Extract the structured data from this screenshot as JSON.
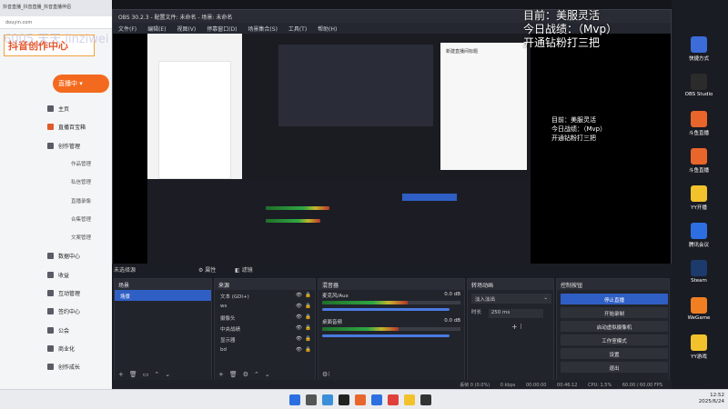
{
  "browser": {
    "tab_text": "抖音直播_抖音直播_抖音直播伴侣",
    "url": "douyin.com",
    "logo_text": "抖音创作中心",
    "live_button": "直播中",
    "nav": [
      {
        "label": "主页",
        "type": "main",
        "active": false
      },
      {
        "label": "直播百宝箱",
        "type": "main",
        "active": true
      },
      {
        "label": "创作管理",
        "type": "main",
        "active": false
      },
      {
        "label": "作品管理",
        "type": "sub",
        "active": false
      },
      {
        "label": "私信管理",
        "type": "sub",
        "active": false
      },
      {
        "label": "直播录像",
        "type": "sub",
        "active": false
      },
      {
        "label": "合集管理",
        "type": "sub",
        "active": false
      },
      {
        "label": "文案管理",
        "type": "sub",
        "active": false
      },
      {
        "label": "数据中心",
        "type": "main",
        "active": false
      },
      {
        "label": "收益",
        "type": "main",
        "active": false
      },
      {
        "label": "互动管理",
        "type": "main",
        "active": false
      },
      {
        "label": "签约中心",
        "type": "main",
        "active": false
      },
      {
        "label": "公会",
        "type": "main",
        "active": false
      },
      {
        "label": "商业化",
        "type": "main",
        "active": false
      },
      {
        "label": "创作成长",
        "type": "main",
        "active": false
      }
    ]
  },
  "watermark": {
    "text": "6005 天天 linziwei"
  },
  "obs": {
    "title": "OBS 30.2.3 - 配置文件: 未命名 - 场景: 未命名",
    "menu": [
      "文件(F)",
      "编辑(E)",
      "视图(V)",
      "停靠窗口(D)",
      "场景集合(S)",
      "工具(T)",
      "帮助(H)"
    ],
    "status_overlay": [
      "目前：美服灵活",
      "今日战绩：（Mvp）",
      "开通钻粉打三把"
    ],
    "right_panel_title": "新建直播间标题",
    "no_source_label": "未选择源",
    "properties_label": "属性",
    "filters_label": "滤镜",
    "docks": {
      "scenes": {
        "title": "场景",
        "items": [
          "场景"
        ]
      },
      "sources": {
        "title": "来源",
        "items": [
          "文本 (GDI+)",
          "ws",
          "摄像头",
          "中央战绩",
          "显示器",
          "bd"
        ]
      },
      "mixer": {
        "title": "混音器",
        "channels": [
          {
            "name": "麦克风/Aux",
            "db": "0.0 dB",
            "level": 0.62
          },
          {
            "name": "桌面音频",
            "db": "0.0 dB",
            "level": 0.55
          }
        ]
      },
      "transitions": {
        "title": "转场动画",
        "type": "淡入淡出",
        "duration_label": "时长",
        "duration": "250 ms"
      },
      "controls": {
        "title": "控制按钮",
        "buttons": [
          "停止直播",
          "开始录制",
          "启动虚拟摄像机",
          "工作室模式",
          "设置",
          "退出"
        ]
      }
    },
    "statusbar": {
      "frames": "丢帧 0 (0.0%)",
      "net": "0 kbps",
      "time1": "00:00:00",
      "time2": "00:46:12",
      "cpu": "CPU: 1.5%",
      "fps": "60.00 / 60.00 FPS"
    }
  },
  "desktop_icons": [
    {
      "label": "快捷方式",
      "color": "#3b6cd8"
    },
    {
      "label": "OBS Studio",
      "color": "#2b2b2b"
    },
    {
      "label": "斗鱼直播",
      "color": "#e8662b"
    },
    {
      "label": "斗鱼直播",
      "color": "#e8662b"
    },
    {
      "label": "YY开播",
      "color": "#f2c22d"
    },
    {
      "label": "腾讯会议",
      "color": "#2d6fe0"
    },
    {
      "label": "Steam",
      "color": "#1c3a6b"
    },
    {
      "label": "WeGame",
      "color": "#f07f22"
    },
    {
      "label": "YY游戏",
      "color": "#f2c22d"
    }
  ],
  "clock": {
    "time": "12:52",
    "date": "2025/6/24"
  }
}
